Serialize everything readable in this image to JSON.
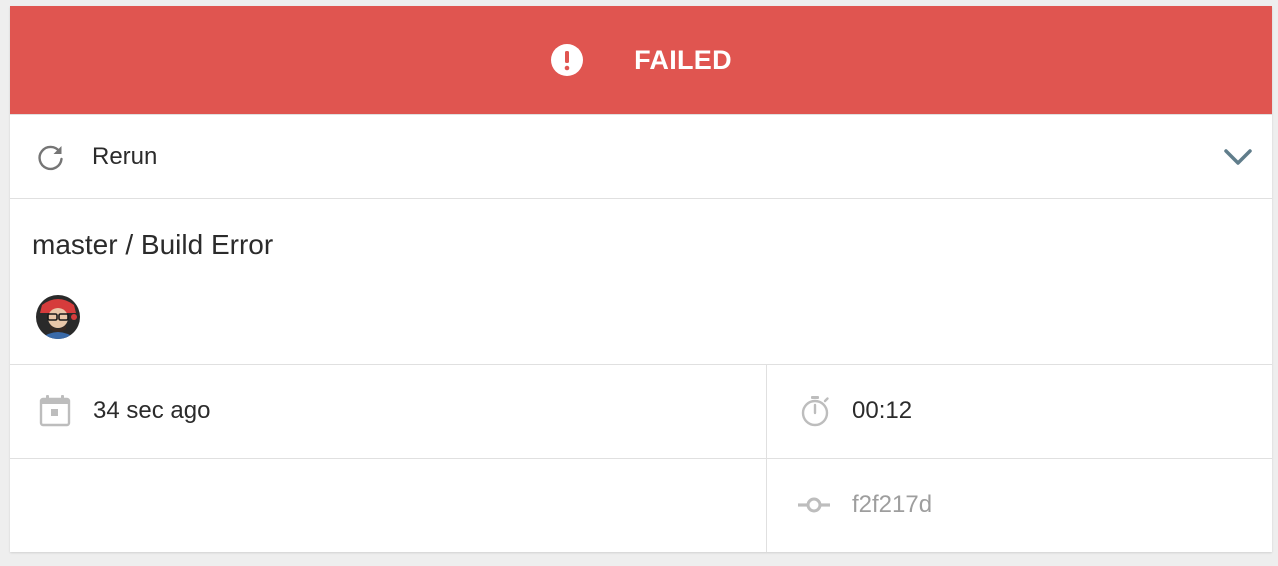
{
  "status": {
    "label": "FAILED",
    "color": "#e05550",
    "icon": "exclamation-circle-icon"
  },
  "actions": {
    "rerun_label": "Rerun",
    "rerun_icon": "refresh-icon",
    "expand_icon": "chevron-down-icon"
  },
  "build": {
    "title": "master / Build Error",
    "author_avatar": "avatar"
  },
  "details": {
    "started": "34 sec ago",
    "started_icon": "calendar-icon",
    "duration": "00:12",
    "duration_icon": "stopwatch-icon",
    "commit": "f2f217d",
    "commit_icon": "commit-icon"
  }
}
